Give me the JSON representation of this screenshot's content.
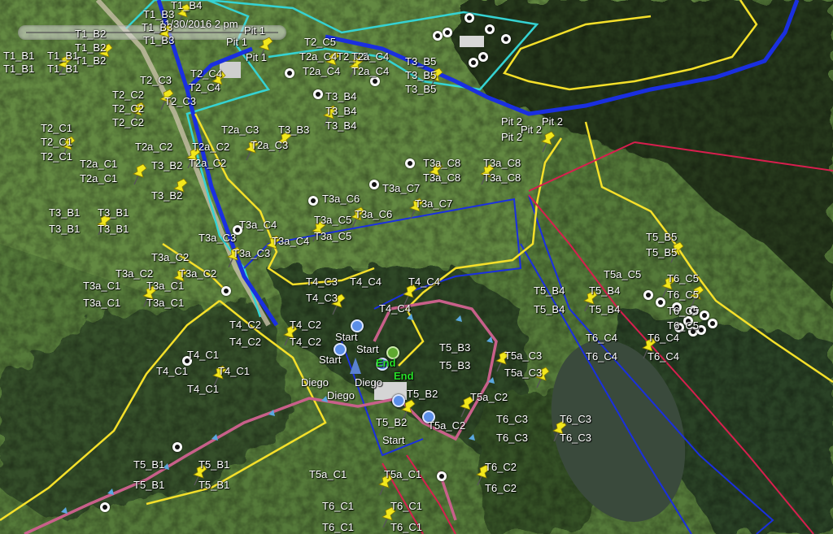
{
  "timestamp": "11/30/2016   2 pm",
  "colors": {
    "yellow": "#f5e02a",
    "cyan": "#35d3d3",
    "blue": "#1a2fe0",
    "red": "#d81e4e",
    "pink": "#c8608a",
    "pin": "#f2e81c"
  },
  "icons": {
    "pin": "yellow-pushpin-icon",
    "dot": "white-ring-marker-icon",
    "start": "blue-start-marker-icon",
    "end": "green-end-marker-icon",
    "diego": "blue-arrow-marker-icon"
  },
  "labels": {
    "t1b4": "T1_B4",
    "t1b3a": "T1_B3",
    "t1b3b": "T1_B3",
    "t1b3c": "T1_B3",
    "t1b2a": "T1_B2",
    "t1b2b": "T1_B2",
    "t1b2c": "T1_B2",
    "t1b1a": "T1_B1",
    "t1b1b": "T1_B1",
    "t1b1c": "T1_B1",
    "t1b1d": "T1_B1",
    "pit1a": "Pit 1",
    "pit1b": "Pit 1",
    "pit1c": "Pit 1",
    "t2c5a": "T2_C5",
    "t2c5b": "T2_C5",
    "t2ac4a": "T2a_C4",
    "t2ac4b": "T2a_C4",
    "t2ac4c": "T2a_C4",
    "t2ac4d": "T2a_C4",
    "t3b5a": "T3_B5",
    "t3b5b": "T3_B5",
    "t3b5c": "T3_B5",
    "t2c4a": "T2_C4",
    "t2c4b": "T2_C4",
    "t2c3a": "T2_C3",
    "t2c3b": "T2_C3",
    "t2c2a": "T2_C2",
    "t2c2b": "T2_C2",
    "t2c2c": "T2_C2",
    "t3b4a": "T3_B4",
    "t3b4b": "T3_B4",
    "t3b4c": "T3_B4",
    "t2c1a": "T2_C1",
    "t2c1b": "T2_C1",
    "t2c1c": "T2_C1",
    "t2ac3a": "T2a_C3",
    "t3b3": "T3_B3",
    "t2ac3b": "T2a_C3",
    "t2ac2a": "T2a_C2",
    "t2ac2b": "T2a_C2",
    "t2ac2c": "T2a_C2",
    "t2ac1a": "T2a_C1",
    "t2ac1b": "T2a_C1",
    "t3b2a": "T3_B2",
    "t3b2b": "T3_B2",
    "pit2a": "Pit 2",
    "pit2b": "Pit 2",
    "pit2c": "Pit 2",
    "pit2d": "Pit 2",
    "t3ac8a": "T3a_C8",
    "t3ac8b": "T3a_C8",
    "t3ac8c": "T3a_C8",
    "t3ac8d": "T3a_C8",
    "t3ac7a": "T3a_C7",
    "t3ac7b": "T3a_C7",
    "t3ac6a": "T3a_C6",
    "t3ac6b": "T3a_C6",
    "t3b1a": "T3_B1",
    "t3b1b": "T3_B1",
    "t3b1c": "T3_B1",
    "t3b1d": "T3_B1",
    "t3ac5a": "T3a_C5",
    "t3ac5b": "T3a_C5",
    "t3ac4a": "T3a_C4",
    "t3ac4b": "T3a_C4",
    "t3ac3a": "T3a_C3",
    "t3ac3b": "T3a_C3",
    "t3ac2a": "T3a_C2",
    "t3ac2b": "T3a_C2",
    "t3ac2c": "T3a_C2",
    "t3ac1a": "T3a_C1",
    "t3ac1b": "T3a_C1",
    "t3ac1c": "T3a_C1",
    "t3ac1d": "T3a_C1",
    "t4c3a": "T4_C3",
    "t4c3b": "T4_C3",
    "t4c4a": "T4_C4",
    "t4c4b": "T4_C4",
    "t4c4c": "T4_C4",
    "t4c2a": "T4_C2",
    "t4c2b": "T4_C2",
    "t4c2c": "T4_C2",
    "t4c2d": "T4_C2",
    "start1": "Start",
    "start2": "Start",
    "start3": "Start",
    "start4": "Start",
    "end1": "End",
    "end2": "End",
    "diego1": "Diego",
    "diego2": "Diego",
    "diego3": "Diego",
    "t4c1a": "T4_C1",
    "t4c1b": "T4_C1",
    "t4c1c": "T4_C1",
    "t4c1d": "T4_C1",
    "t5b3a": "T5_B3",
    "t5b3b": "T5_B3",
    "t5ac3a": "T5a_C3",
    "t5ac3b": "T5a_C3",
    "t5b2a": "T5_B2",
    "t5b2b": "T5_B2",
    "t5ac2a": "T5a_C2",
    "t5ac2b": "T5a_C2",
    "t6c3a": "T6_C3",
    "t6c3b": "T6_C3",
    "t6c3c": "T6_C3",
    "t6c3d": "T6_C3",
    "t5b1a": "T5_B1",
    "t5b1b": "T5_B1",
    "t5b1c": "T5_B1",
    "t5b1d": "T5_B1",
    "t5ac1a": "T5a_C1",
    "t5ac1b": "T5a_C1",
    "t6c2a": "T6_C2",
    "t6c2b": "T6_C2",
    "t6c1a": "T6_C1",
    "t6c1b": "T6_C1",
    "t6c1c": "T6_C1",
    "t6c1d": "T6_C1",
    "t5b5a": "T5_B5",
    "t5b5b": "T5_B5",
    "t5ac5": "T5a_C5",
    "t6c5a": "T6_C5",
    "t6c5b": "T6_C5",
    "t6c5c": "T6_C5",
    "t6c5d": "T6_C5",
    "t5b4a": "T5_B4",
    "t5b4b": "T5_B4",
    "t5b4c": "T5_B4",
    "t5b4d": "T5_B4",
    "t6c4a": "T6_C4",
    "t6c4b": "T6_C4",
    "t6c4c": "T6_C4",
    "t6c4d": "T6_C4"
  }
}
